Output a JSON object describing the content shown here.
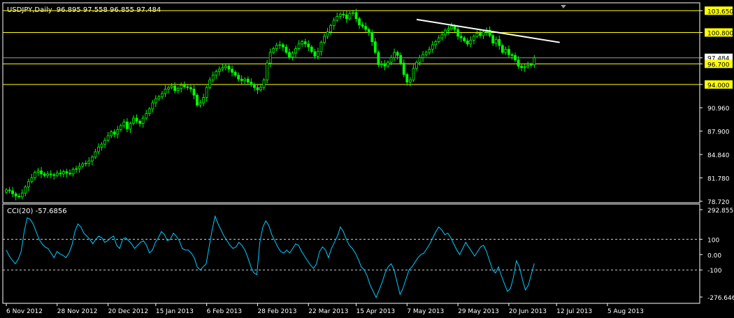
{
  "chart_data": [
    {
      "type": "candlestick",
      "title": "USDJPY,Daily",
      "ohlc_readout": "96.895 97.558 96.855 97.484",
      "symbol": "USDJPY",
      "timeframe": "Daily",
      "ylim": [
        78.72,
        104.5
      ],
      "y_ticks": [
        103.65,
        100.8,
        97.484,
        96.7,
        94.0,
        90.96,
        87.9,
        84.84,
        81.78,
        78.72
      ],
      "y_tick_labels": [
        "103.650",
        "100.800",
        "97.484",
        "96.700",
        "94.000",
        "90.960",
        "87.900",
        "84.840",
        "81.780",
        "78.720"
      ],
      "highlighted_levels": [
        {
          "value": 103.65,
          "label": "103.650",
          "color": "#ffff00"
        },
        {
          "value": 100.8,
          "label": "100.800",
          "color": "#ffff00"
        },
        {
          "value": 96.7,
          "label": "96.700",
          "color": "#ffff00"
        },
        {
          "value": 94.0,
          "label": "94.000",
          "color": "#ffff00"
        }
      ],
      "current_price": {
        "value": 97.484,
        "label": "97.484"
      },
      "x_ticks": [
        "6 Nov 2012",
        "28 Nov 2012",
        "20 Dec 2012",
        "15 Jan 2013",
        "6 Feb 2013",
        "28 Feb 2013",
        "22 Mar 2013",
        "15 Apr 2013",
        "7 May 2013",
        "29 May 2013",
        "20 Jun 2013",
        "12 Jul 2013",
        "5 Aug 2013"
      ],
      "close_series": [
        80.2,
        80.1,
        79.7,
        79.4,
        79.3,
        79.8,
        80.6,
        81.3,
        81.8,
        82.5,
        82.7,
        82.3,
        82.1,
        82.3,
        82.2,
        82.1,
        82.4,
        82.3,
        82.6,
        82.4,
        82.3,
        82.9,
        83.0,
        83.3,
        83.6,
        83.7,
        84.0,
        84.5,
        85.2,
        85.8,
        86.2,
        86.7,
        87.3,
        87.8,
        87.5,
        88.1,
        88.6,
        89.1,
        88.2,
        88.9,
        89.6,
        89.2,
        88.9,
        89.6,
        90.2,
        90.8,
        91.6,
        92.1,
        92.4,
        92.8,
        93.4,
        93.6,
        93.8,
        93.2,
        93.5,
        93.9,
        93.7,
        93.6,
        93.4,
        92.6,
        91.3,
        91.6,
        92.3,
        93.6,
        94.6,
        95.2,
        95.7,
        96.0,
        96.2,
        96.4,
        96.0,
        95.6,
        95.2,
        94.7,
        94.5,
        94.7,
        94.3,
        94.0,
        93.6,
        93.3,
        93.6,
        94.6,
        96.8,
        98.2,
        98.7,
        99.1,
        99.2,
        98.9,
        98.2,
        97.6,
        98.1,
        98.7,
        99.3,
        99.6,
        99.3,
        98.9,
        98.3,
        97.7,
        98.3,
        99.5,
        100.3,
        100.9,
        101.7,
        102.4,
        102.9,
        103.2,
        103.1,
        102.6,
        103.3,
        103.4,
        102.6,
        101.8,
        101.6,
        101.2,
        100.8,
        99.6,
        98.2,
        96.6,
        96.7,
        96.4,
        96.9,
        97.5,
        98.2,
        97.8,
        96.8,
        95.3,
        94.3,
        94.6,
        96.1,
        96.9,
        97.5,
        97.9,
        98.2,
        98.6,
        99.2,
        99.6,
        100.1,
        100.5,
        101.1,
        101.3,
        101.6,
        101.2,
        100.3,
        100.1,
        99.7,
        99.3,
        99.8,
        100.3,
        100.7,
        100.4,
        100.9,
        101.1,
        100.4,
        99.4,
        99.9,
        99.1,
        98.2,
        98.6,
        97.9,
        97.8,
        97.2,
        96.4,
        96.2,
        96.3,
        96.5,
        96.6,
        97.48
      ],
      "trendline": {
        "from": {
          "bar": 129,
          "price": 102.5
        },
        "to": {
          "bar": 174,
          "price": 99.5
        },
        "color": "#ffffff"
      },
      "candle_color": "#00ff00",
      "grid": false
    },
    {
      "type": "line",
      "title": "CCI(20) -57.6856",
      "indicator": "CCI(20)",
      "value_label": "-57.6856",
      "ylim": [
        -276.6463,
        292.8552
      ],
      "y_ticks": [
        292.8552,
        100,
        0,
        -100,
        -276.6463
      ],
      "y_tick_labels": [
        "292.8552",
        "100",
        "0.00",
        "-100",
        "-276.646"
      ],
      "levels": [
        100,
        -100
      ],
      "series": [
        {
          "color": "#00ccff",
          "values": [
            30,
            -10,
            -35,
            -60,
            -30,
            20,
            150,
            240,
            230,
            200,
            150,
            100,
            70,
            50,
            40,
            10,
            -20,
            20,
            5,
            -5,
            -20,
            10,
            60,
            150,
            200,
            180,
            140,
            120,
            100,
            70,
            100,
            120,
            110,
            80,
            90,
            110,
            120,
            60,
            40,
            100,
            110,
            90,
            70,
            40,
            60,
            80,
            90,
            60,
            10,
            30,
            80,
            110,
            150,
            130,
            90,
            100,
            140,
            120,
            90,
            40,
            30,
            30,
            10,
            -20,
            -80,
            -100,
            -80,
            -60,
            50,
            160,
            250,
            200,
            160,
            120,
            90,
            60,
            40,
            50,
            80,
            60,
            30,
            -20,
            -80,
            -120,
            -130,
            80,
            180,
            220,
            190,
            130,
            90,
            50,
            20,
            10,
            30,
            10,
            40,
            70,
            60,
            20,
            -10,
            -40,
            -70,
            -90,
            -60,
            20,
            50,
            30,
            -20,
            40,
            80,
            120,
            180,
            150,
            100,
            60,
            40,
            10,
            -30,
            -80,
            -100,
            -140,
            -200,
            -240,
            -280,
            -230,
            -180,
            -120,
            -80,
            -60,
            -100,
            -180,
            -260,
            -220,
            -160,
            -100,
            -80,
            -50,
            -20,
            0,
            10,
            40,
            70,
            110,
            150,
            180,
            160,
            130,
            140,
            110,
            70,
            30,
            0,
            40,
            80,
            50,
            20,
            -10,
            20,
            50,
            60,
            20,
            -40,
            -100,
            -120,
            -80,
            -140,
            -190,
            -240,
            -220,
            -150,
            -40,
            -80,
            -160,
            -230,
            -200,
            -130,
            -57.69
          ]
        }
      ],
      "grid": false
    }
  ]
}
